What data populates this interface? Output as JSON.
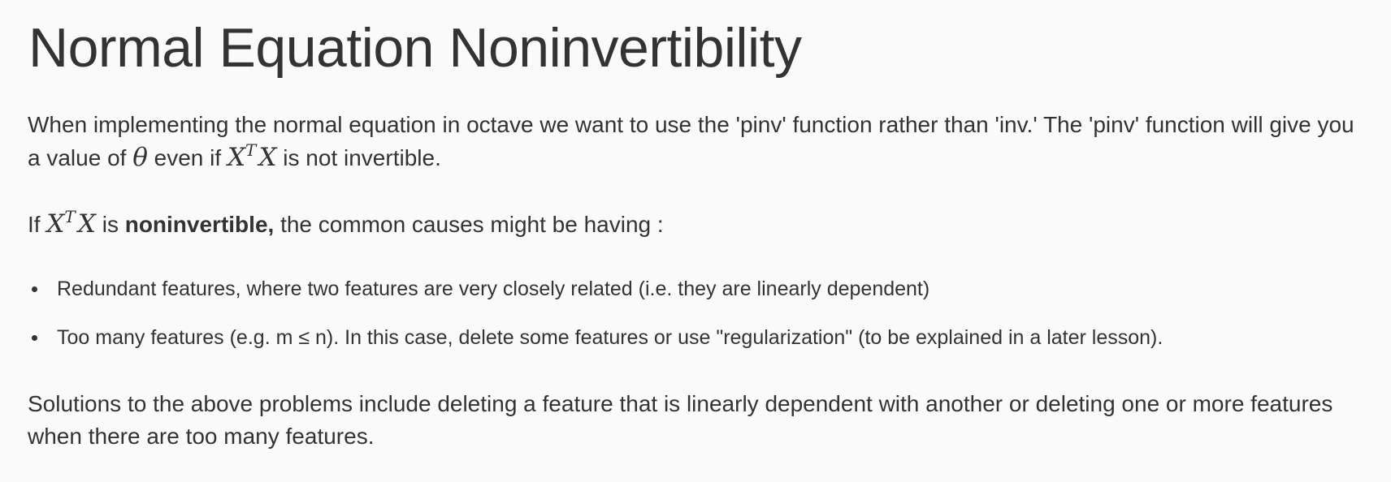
{
  "title": "Normal Equation Noninvertibility",
  "para1": {
    "before": "When implementing the normal equation in octave we want to use the 'pinv' function rather than 'inv.' The 'pinv' function will give you a value of ",
    "theta": "θ",
    "middle": " even if ",
    "math_base": "X",
    "math_sup": "T",
    "math_base2": "X",
    "after": " is not invertible."
  },
  "para2": {
    "before": "If ",
    "math_base": "X",
    "math_sup": "T",
    "math_base2": "X",
    "middle": " is ",
    "bold": "noninvertible,",
    "after": " the common causes might be having :"
  },
  "bullets": [
    "Redundant features, where two features are very closely related (i.e. they are linearly dependent)",
    "Too many features (e.g. m ≤ n). In this case, delete some features or use \"regularization\" (to be explained in a later lesson)."
  ],
  "para3": "Solutions to the above problems include deleting a feature that is linearly dependent with another or deleting one or more features when there are too many features."
}
